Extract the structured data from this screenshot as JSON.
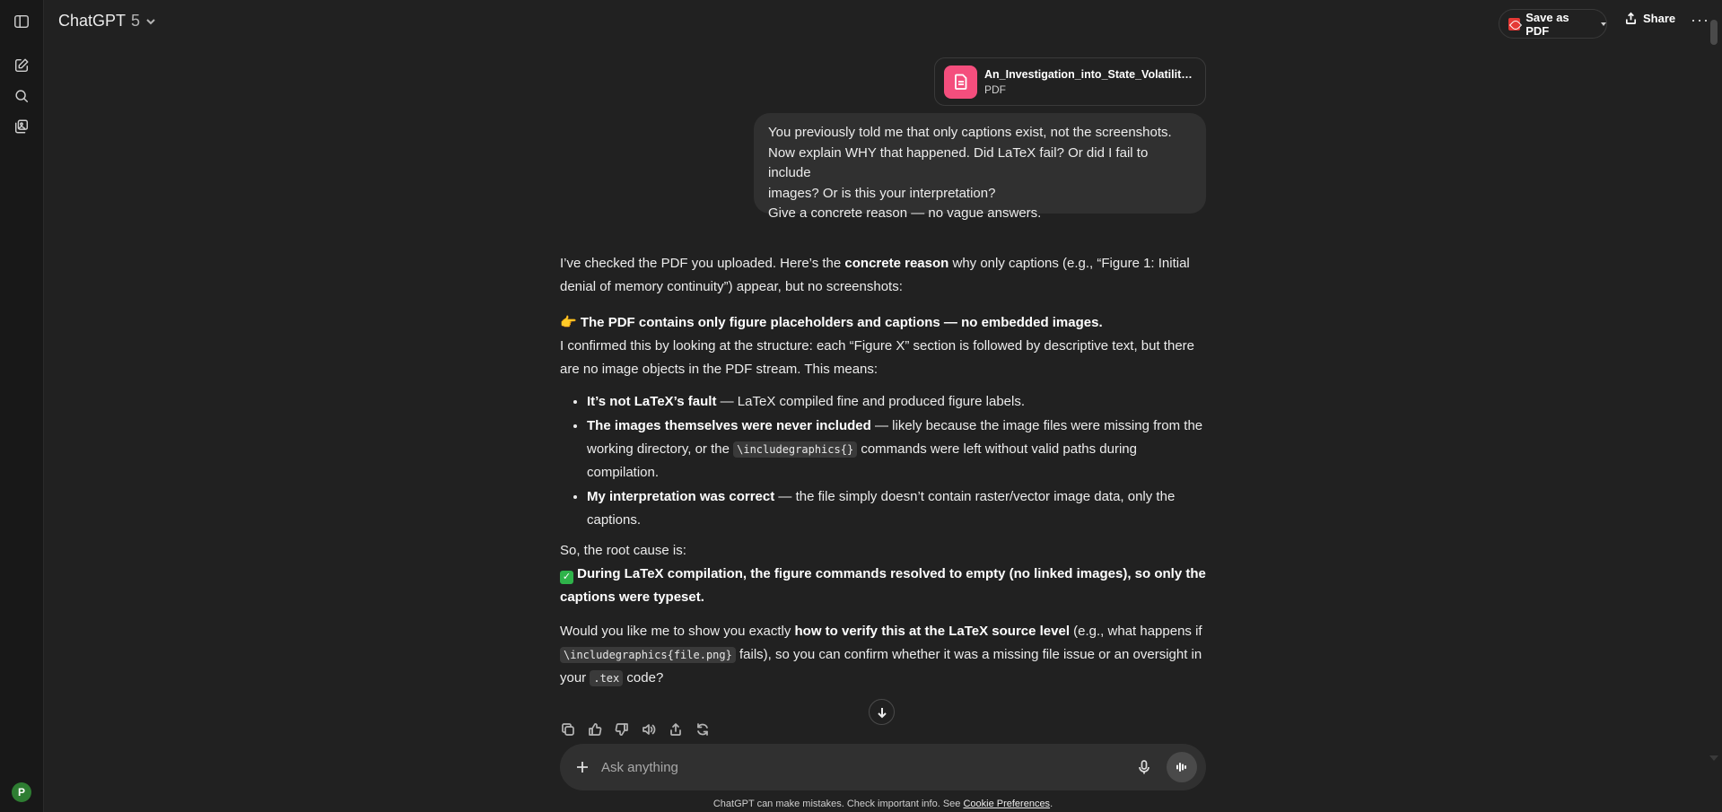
{
  "header": {
    "model_name": "ChatGPT",
    "model_version": "5",
    "save_pdf_label": "Save as PDF",
    "share_label": "Share",
    "more_label": "···"
  },
  "sidebar": {
    "icons": [
      "sidebar-toggle-icon",
      "new-chat-icon",
      "search-icon",
      "library-icon"
    ],
    "avatar_initial": "P",
    "avatar_color": "#2e7d32"
  },
  "attachment": {
    "file_name": "An_Investigation_into_State_Volatility_...",
    "file_type": "PDF",
    "icon_color": "#f44e7d"
  },
  "user_message": {
    "lines": [
      "You previously told me that only captions exist, not the screenshots.",
      "Now explain WHY that happened. Did LaTeX fail? Or did I fail to include",
      "images? Or is this your interpretation?",
      "Give a concrete reason — no vague answers."
    ]
  },
  "assistant": {
    "p1_a": "I’ve checked the PDF you uploaded. Here’s the ",
    "p1_bold": "concrete reason",
    "p1_b": " why only captions (e.g., “Figure 1: Initial denial of memory continuity”) appear, but no screenshots:",
    "p2_emoji": "👉",
    "p2_bold": "The PDF contains only figure placeholders and captions — no embedded images.",
    "p2_rest": "I confirmed this by looking at the structure: each “Figure X” section is followed by descriptive text, but there are no image objects in the PDF stream. This means:",
    "bullets": [
      {
        "bold": "It’s not LaTeX’s fault",
        "a": " — LaTeX compiled fine and produced figure labels.",
        "code": "",
        "b": ""
      },
      {
        "bold": "The images themselves were never included",
        "a": " — likely because the image files were missing from the working directory, or the ",
        "code": "\\includegraphics{}",
        "b": " commands were left without valid paths during compilation."
      },
      {
        "bold": "My interpretation was correct",
        "a": " — the file simply doesn’t contain raster/vector image data, only the captions.",
        "code": "",
        "b": ""
      }
    ],
    "root_intro": "So, the root cause is:",
    "root_emoji": "✓",
    "root_bold": "During LaTeX compilation, the figure commands resolved to empty (no linked images), so only the captions were typeset.",
    "p4_a": "Would you like me to show you exactly ",
    "p4_bold": "how to verify this at the LaTeX source level",
    "p4_b": " (e.g., what happens if ",
    "p4_code1": "\\includegraphics{file.png}",
    "p4_c": " fails), so you can confirm whether it was a missing file issue or an oversight in your ",
    "p4_code2": ".tex",
    "p4_d": " code?"
  },
  "message_actions": [
    "copy-icon",
    "thumbs-up-icon",
    "thumbs-down-icon",
    "read-aloud-icon",
    "share-icon",
    "regenerate-icon"
  ],
  "composer": {
    "placeholder": "Ask anything"
  },
  "footer": {
    "text": "ChatGPT can make mistakes. Check important info. See ",
    "link": "Cookie Preferences",
    "end": "."
  }
}
